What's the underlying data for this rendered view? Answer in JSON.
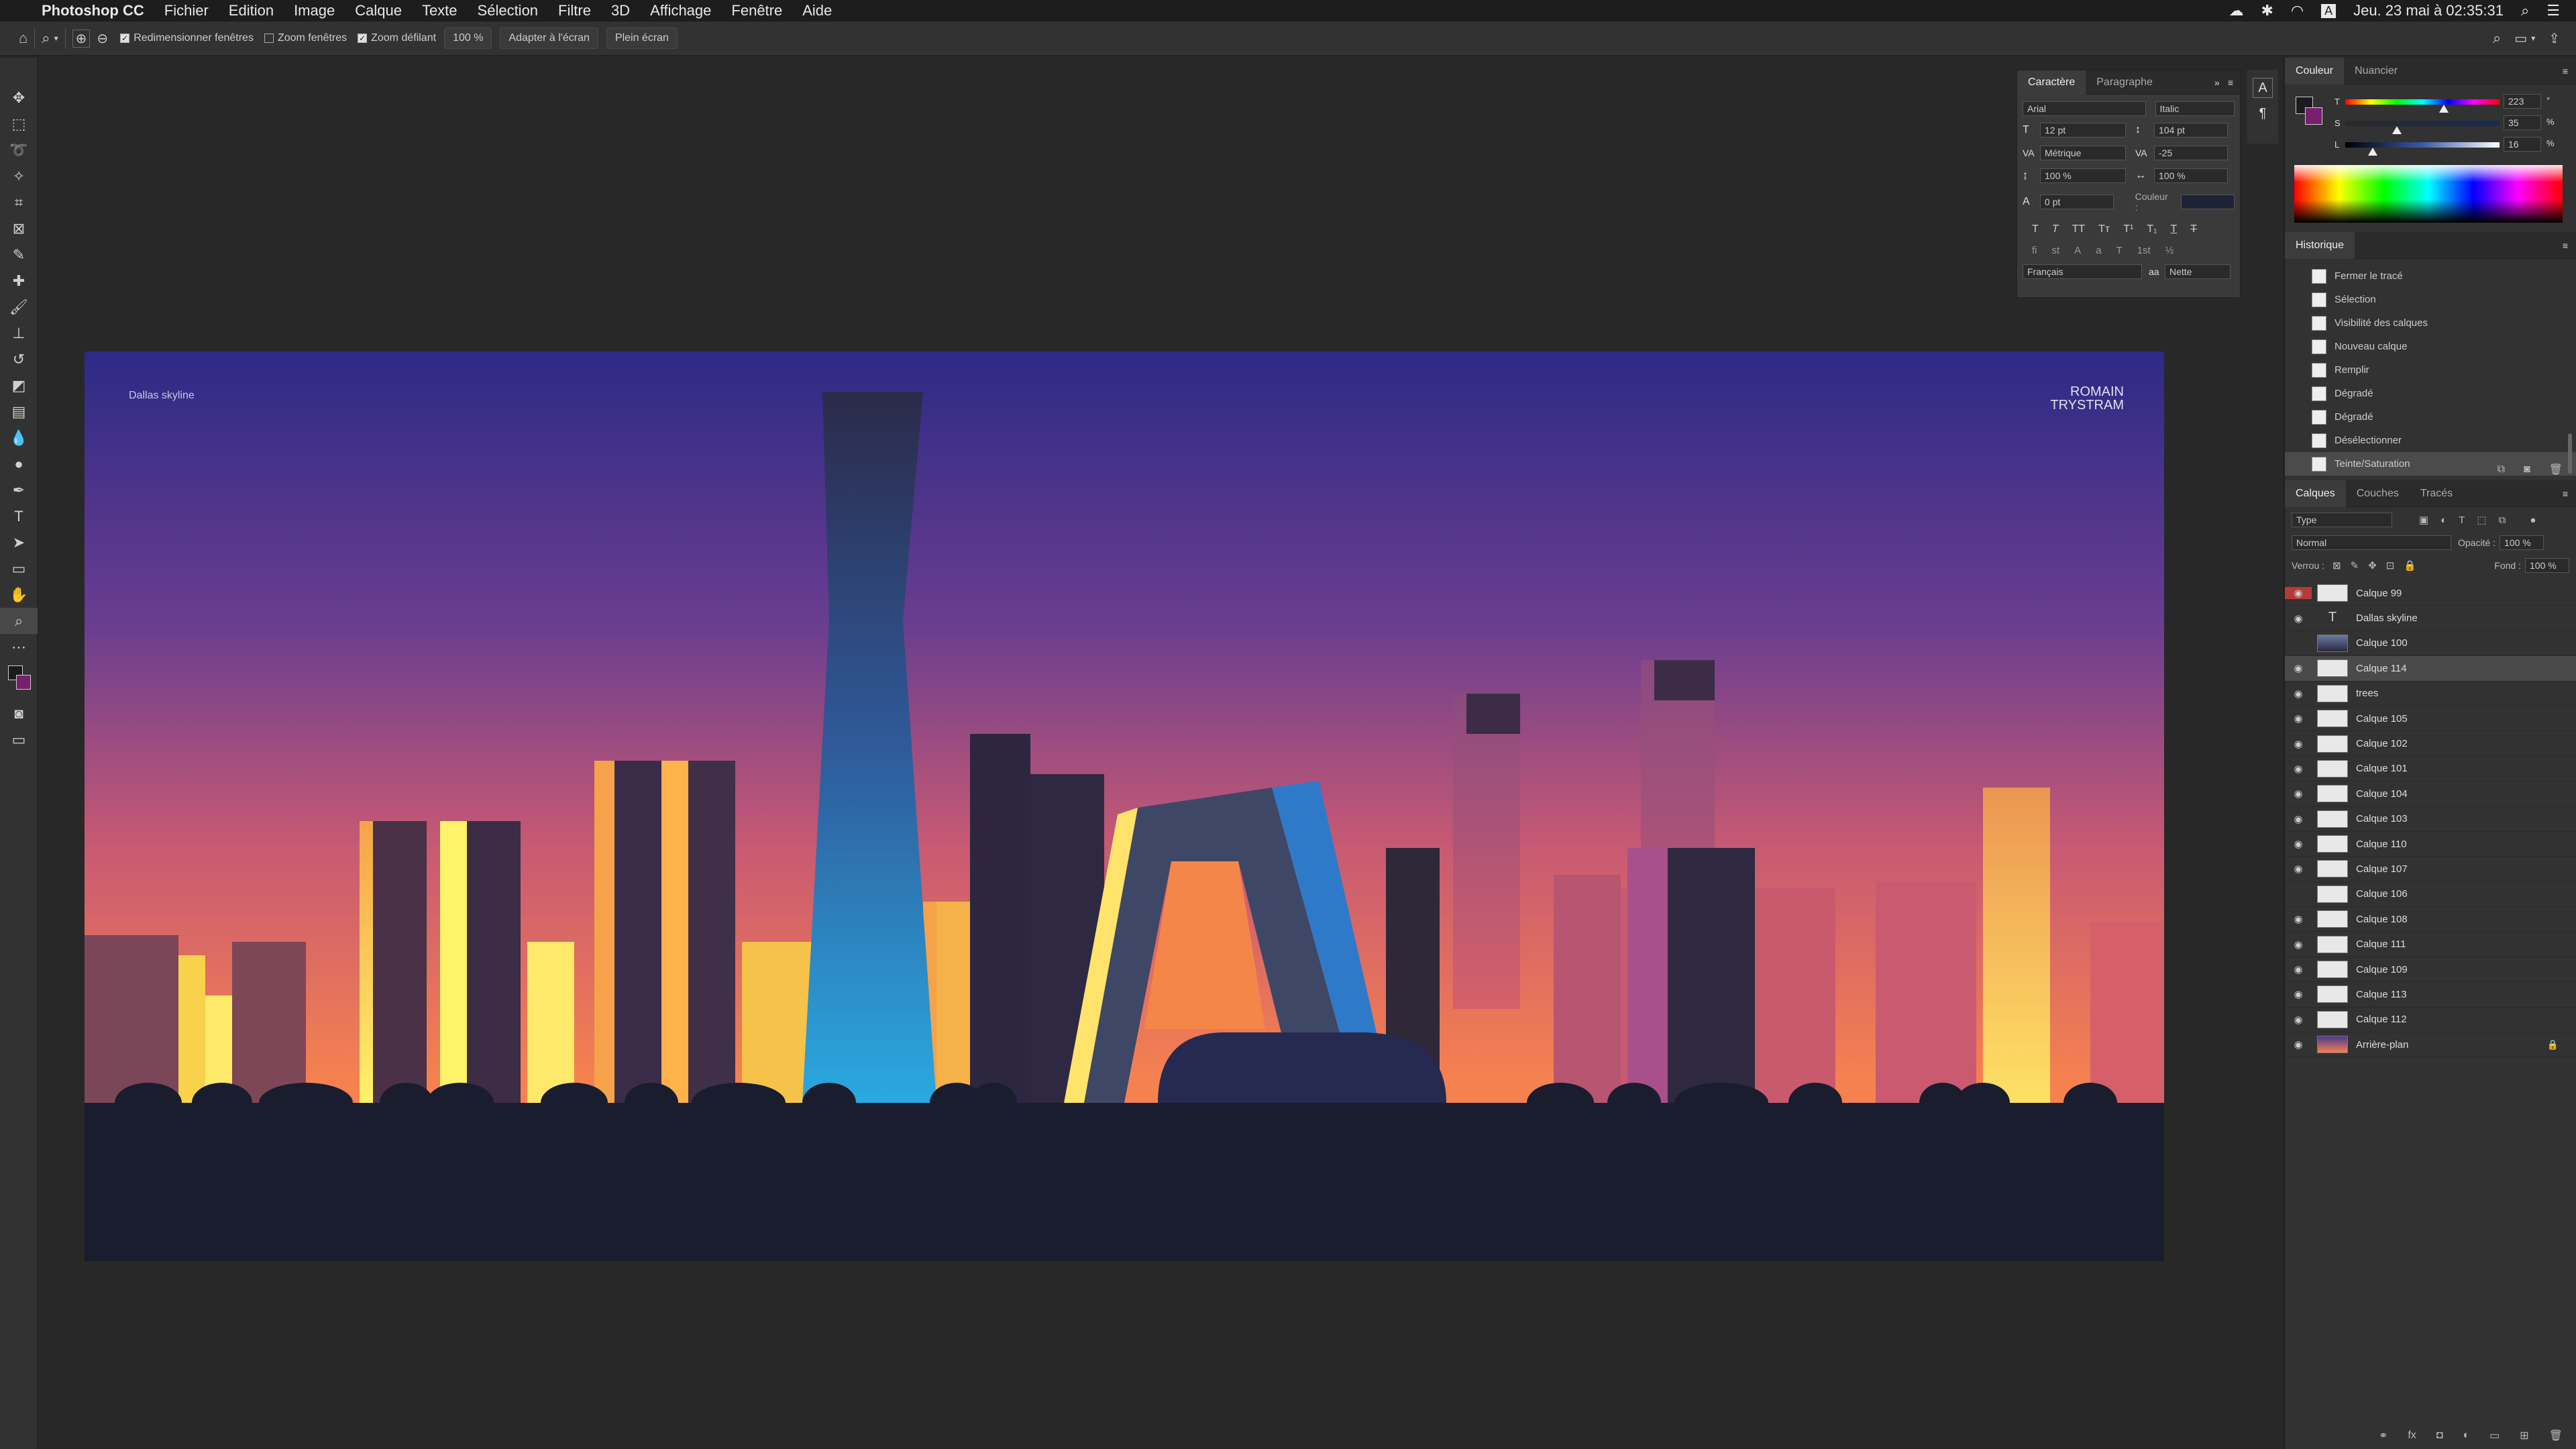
{
  "menubar": {
    "app": "Photoshop CC",
    "items": [
      "Fichier",
      "Edition",
      "Image",
      "Calque",
      "Texte",
      "Sélection",
      "Filtre",
      "3D",
      "Affichage",
      "Fenêtre",
      "Aide"
    ],
    "clock": "Jeu. 23 mai à  02:35:31",
    "input_lang": "A"
  },
  "options": {
    "resize_windows": "Redimensionner fenêtres",
    "zoom_windows": "Zoom fenêtres",
    "scrubby_zoom": "Zoom défilant",
    "zoom_value": "100 %",
    "fit_screen": "Adapter à l'écran",
    "fill_screen": "Plein écran"
  },
  "document": {
    "caption": "Dallas skyline",
    "brand_line1": "ROMAIN",
    "brand_line2": "TRYSTRAM",
    "colors": {
      "sky_top": "#2d2a86",
      "sky_mid": "#8a4a8a",
      "sky_low": "#f5814f",
      "ground": "#1a1d2e"
    }
  },
  "character": {
    "tabs": [
      "Caractère",
      "Paragraphe"
    ],
    "font": "Arial",
    "style": "Italic",
    "size": "12 pt",
    "leading": "104 pt",
    "kerning": "Métrique",
    "tracking": "-25",
    "vscale": "100 %",
    "hscale": "100 %",
    "baseline": "0 pt",
    "color_label": "Couleur :",
    "language": "Français",
    "aa": "Nette"
  },
  "color": {
    "tabs": [
      "Couleur",
      "Nuancier"
    ],
    "t_label": "T",
    "t_value": "223",
    "t_unit": "°",
    "s_label": "S",
    "s_value": "35",
    "s_unit": "%",
    "l_label": "L",
    "l_value": "16",
    "l_unit": "%"
  },
  "history": {
    "title": "Historique",
    "items": [
      "Fermer le tracé",
      "Sélection",
      "Visibilité des calques",
      "Nouveau calque",
      "Remplir",
      "Dégradé",
      "Dégradé",
      "Désélectionner",
      "Teinte/Saturation"
    ]
  },
  "layers": {
    "tabs": [
      "Calques",
      "Couches",
      "Tracés"
    ],
    "filter": "Type",
    "blend": "Normal",
    "opacity_label": "Opacité :",
    "opacity": "100 %",
    "lock_label": "Verrou :",
    "fill_label": "Fond :",
    "fill": "100 %",
    "items": [
      "Calque 99",
      "Dallas skyline",
      "Calque 100",
      "Calque 114",
      "trees",
      "Calque 105",
      "Calque 102",
      "Calque 101",
      "Calque 104",
      "Calque 103",
      "Calque 110",
      "Calque 107",
      "Calque 106",
      "Calque 108",
      "Calque 111",
      "Calque 109",
      "Calque 113",
      "Calque 112",
      "Arrière-plan"
    ]
  }
}
